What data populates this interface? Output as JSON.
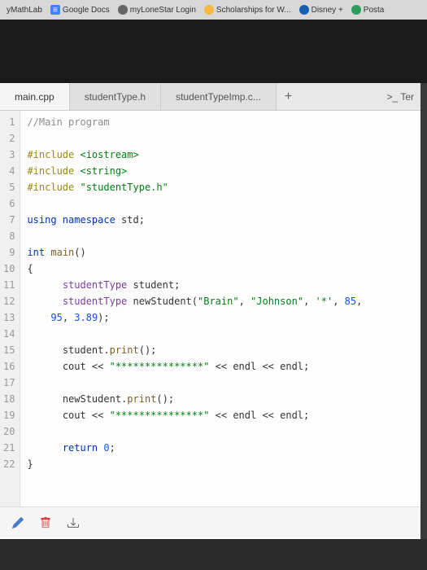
{
  "bookmarks": [
    {
      "label": "yMathLab",
      "icon": ""
    },
    {
      "label": "Google Docs",
      "icon": "≡"
    },
    {
      "label": "myLoneStar Login",
      "icon": "●"
    },
    {
      "label": "Scholarships for W...",
      "icon": "!"
    },
    {
      "label": "Disney +",
      "icon": "⇩"
    },
    {
      "label": "Posta",
      "icon": "●"
    }
  ],
  "tabs": [
    {
      "label": "main.cpp",
      "active": true
    },
    {
      "label": "studentType.h",
      "active": false
    },
    {
      "label": "studentTypeImp.c...",
      "active": false
    }
  ],
  "add_tab": "+",
  "terminal_label": ">_ Ter",
  "line_numbers": [
    "1",
    "2",
    "3",
    "4",
    "5",
    "6",
    "7",
    "8",
    "9",
    "10",
    "11",
    "12",
    "",
    "13",
    "14",
    "15",
    "16",
    "17",
    "18",
    "19",
    "20",
    "21",
    "22"
  ],
  "code": {
    "l1_cmt": "//Main program",
    "l3_inc": "#include",
    "l3_hdr": " <iostream>",
    "l4_inc": "#include",
    "l4_hdr": " <string>",
    "l5_inc": "#include",
    "l5_hdr": " \"studentType.h\"",
    "l7_using": "using",
    "l7_ns": " namespace",
    "l7_std": " std;",
    "l9_int": "int",
    "l9_main": " main",
    "l9_p": "()",
    "l10": "{",
    "l11_pad": "      ",
    "l11_type": "studentType",
    "l11_var": " student;",
    "l12_pad": "      ",
    "l12_type": "studentType",
    "l12_var": " newStudent(",
    "l12_s1": "\"Brain\"",
    "l12_c1": ", ",
    "l12_s2": "\"Johnson\"",
    "l12_c2": ", ",
    "l12_ch": "'*'",
    "l12_c3": ", ",
    "l12_n1": "85",
    "l12_c4": ",",
    "l12b_pad": "    ",
    "l12b_n1": "95",
    "l12b_c1": ", ",
    "l12b_n2": "3.89",
    "l12b_c2": ");",
    "l14_pad": "      ",
    "l14_obj": "student.",
    "l14_fn": "print",
    "l14_p": "();",
    "l15_pad": "      ",
    "l15_cout": "cout << ",
    "l15_str": "\"***************\"",
    "l15_end": " << endl << endl;",
    "l17_pad": "      ",
    "l17_obj": "newStudent.",
    "l17_fn": "print",
    "l17_p": "();",
    "l18_pad": "      ",
    "l18_cout": "cout << ",
    "l18_str": "\"***************\"",
    "l18_end": " << endl << endl;",
    "l20_pad": "      ",
    "l20_ret": "return",
    "l20_val": " 0",
    "l20_sc": ";",
    "l21": "}"
  },
  "toolbar": {
    "edit": "✎",
    "delete": "🗑",
    "download": "⬇"
  }
}
